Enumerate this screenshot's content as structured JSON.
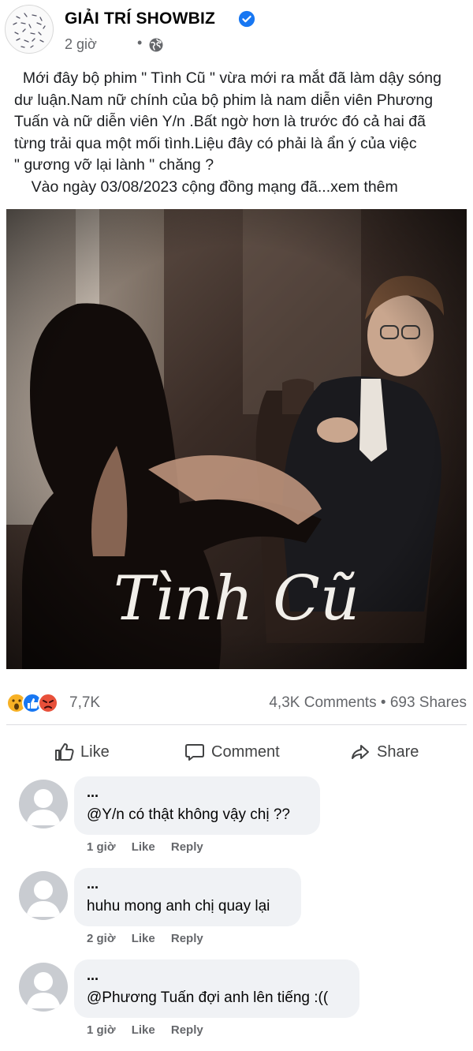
{
  "post": {
    "page_name": "GIẢI TRÍ SHOWBIZ",
    "time": "2 giờ",
    "separator": "•",
    "caption_lines": [
      "  Mới đây bộ phim \" Tình Cũ \" vừa mới ra mắt đã làm dậy sóng",
      "dư luận.Nam nữ chính của bộ phim là nam diễn viên Phương",
      "Tuấn và nữ diễn viên Y/n .Bất ngờ hơn là trước đó cả hai đã",
      "từng trải qua một mối tình.Liệu đây có phải là ẩn ý của việc",
      "\" gương vỡ lại lành \" chăng ?",
      "    Vào ngày 03/08/2023 cộng đồng mạng đã...xem thêm"
    ],
    "photo_title": "Tình Cũ"
  },
  "stats": {
    "reactions_count": "7,7K",
    "comments": "4,3K Comments",
    "dot": "•",
    "shares": "693 Shares"
  },
  "actions": {
    "like": "Like",
    "comment": "Comment",
    "share": "Share"
  },
  "comments": [
    {
      "author": "...",
      "text": "@Y/n có thật không vậy chị ??",
      "time": "1 giờ",
      "like": "Like",
      "reply": "Reply"
    },
    {
      "author": "...",
      "text": "huhu mong anh chị quay lại",
      "time": "2 giờ",
      "like": "Like",
      "reply": "Reply"
    },
    {
      "author": "...",
      "text": "@Phương Tuấn đợi anh lên tiếng :((",
      "time": "1 giờ",
      "like": "Like",
      "reply": "Reply"
    }
  ],
  "colors": {
    "verified_blue": "#1877f2",
    "secondary_text": "#65676b",
    "bubble_bg": "#f0f2f5"
  },
  "icons": [
    "verified-badge-icon",
    "globe-icon",
    "wow-reaction-icon",
    "like-reaction-icon",
    "angry-reaction-icon",
    "like-thumb-icon",
    "comment-bubble-icon",
    "share-arrow-icon"
  ]
}
